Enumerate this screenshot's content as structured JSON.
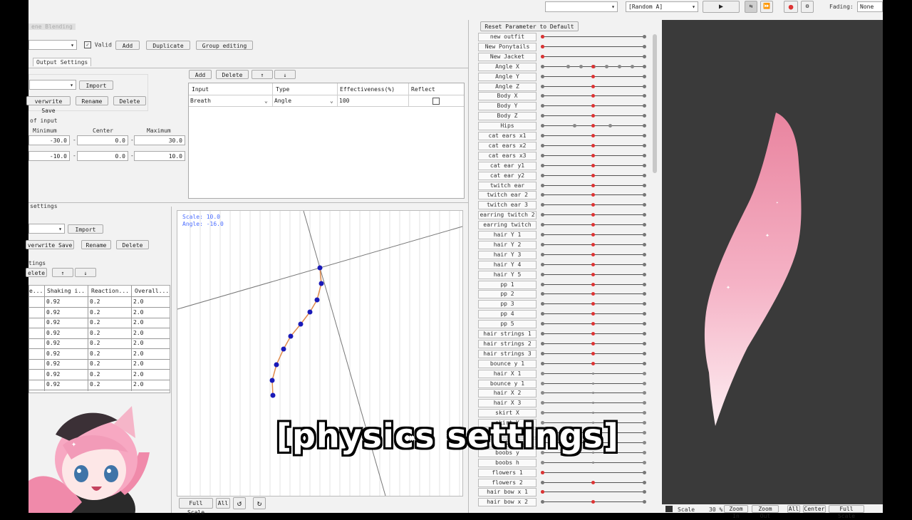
{
  "topbar": {
    "random_select": "[Random A]",
    "fading_label": "Fading:",
    "fading_value": "None"
  },
  "left": {
    "title": "ene Blending",
    "valid_label": "Valid",
    "add": "Add",
    "duplicate": "Duplicate",
    "group_editing": "Group editing",
    "tab_output": "Output Settings",
    "import": "Import",
    "overwrite_save": "verwrite Save",
    "rename": "Rename",
    "delete": "Delete",
    "of_input": "of input",
    "col_min": "Minimum",
    "col_center": "Center",
    "col_max": "Maximum",
    "range_rows": [
      {
        "min": "-30.0",
        "center": "0.0",
        "max": "30.0"
      },
      {
        "min": "-10.0",
        "center": "0.0",
        "max": "10.0"
      }
    ],
    "settings_label": "settings",
    "import2": "Import",
    "overwrite_save2": "verwrite Save",
    "rename2": "Rename",
    "delete2": "Delete",
    "tings_label": "tings",
    "elete": "elete",
    "up": "↑",
    "down": "↓",
    "table_headers": [
      "e...",
      "Shaking i...",
      "Reaction...",
      "Overall..."
    ],
    "table_rows": [
      [
        "0.92",
        "0.2",
        "2.0"
      ],
      [
        "0.92",
        "0.2",
        "2.0"
      ],
      [
        "0.92",
        "0.2",
        "2.0"
      ],
      [
        "0.92",
        "0.2",
        "2.0"
      ],
      [
        "0.92",
        "0.2",
        "2.0"
      ],
      [
        "0.92",
        "0.2",
        "2.0"
      ],
      [
        "0.92",
        "0.2",
        "2.0"
      ],
      [
        "0.92",
        "0.2",
        "2.0"
      ],
      [
        "0.92",
        "0.2",
        "2.0"
      ]
    ]
  },
  "inputs": {
    "add": "Add",
    "delete": "Delete",
    "up": "↑",
    "down": "↓",
    "headers": [
      "Input",
      "Type",
      "Effectiveness(%)",
      "Reflect"
    ],
    "row": {
      "input": "Breath",
      "type": "Angle",
      "effectiveness": "100"
    }
  },
  "graph": {
    "scale": "Scale: 10.0",
    "angle": "Angle: -16.0",
    "full_scale": "Full Scale",
    "all": "All"
  },
  "params": {
    "reset_label": "Reset Parameter to Default",
    "items": [
      "new outfit",
      "New Ponytails",
      "New Jacket",
      "Angle X",
      "Angle Y",
      "Angle Z",
      "Body X",
      "Body Y",
      "Body Z",
      "Hips",
      "cat ears x1",
      "cat ears x2",
      "cat ears x3",
      "cat ear y1",
      "cat ear y2",
      "twitch ear",
      "twitch ear 2",
      "twitch ear 3",
      "earring twitch 2",
      "earring twitch",
      "hair Y 1",
      "hair Y 2",
      "hair Y 3",
      "hair Y 4",
      "hair Y 5",
      "pp 1",
      "pp 2",
      "pp 3",
      "pp 4",
      "pp 5",
      "hair strings 1",
      "hair strings 2",
      "hair strings 3",
      "bounce y 1",
      "hair X 1",
      "bounce y 1",
      "hair X 2",
      "hair X 3",
      "skirt X",
      "skirt Y",
      "skirt Y",
      "boobs x",
      "boobs y",
      "boobs h",
      "flowers 1",
      "flowers 2",
      "hair bow x 1",
      "hair bow x 2"
    ]
  },
  "viewport": {
    "scale_label": "Scale",
    "scale_value": "30 %",
    "zoom_in": "Zoom In",
    "zoom_out": "Zoom Out",
    "all": "All",
    "center": "Center",
    "full_scale": "Full Scale"
  },
  "caption": "[physics settings]",
  "colors": {
    "accent_red": "#d33333",
    "node_blue": "#1a1ab8",
    "viewport_bg": "#3a3a3a",
    "hair_pink": "#f0a7be"
  }
}
